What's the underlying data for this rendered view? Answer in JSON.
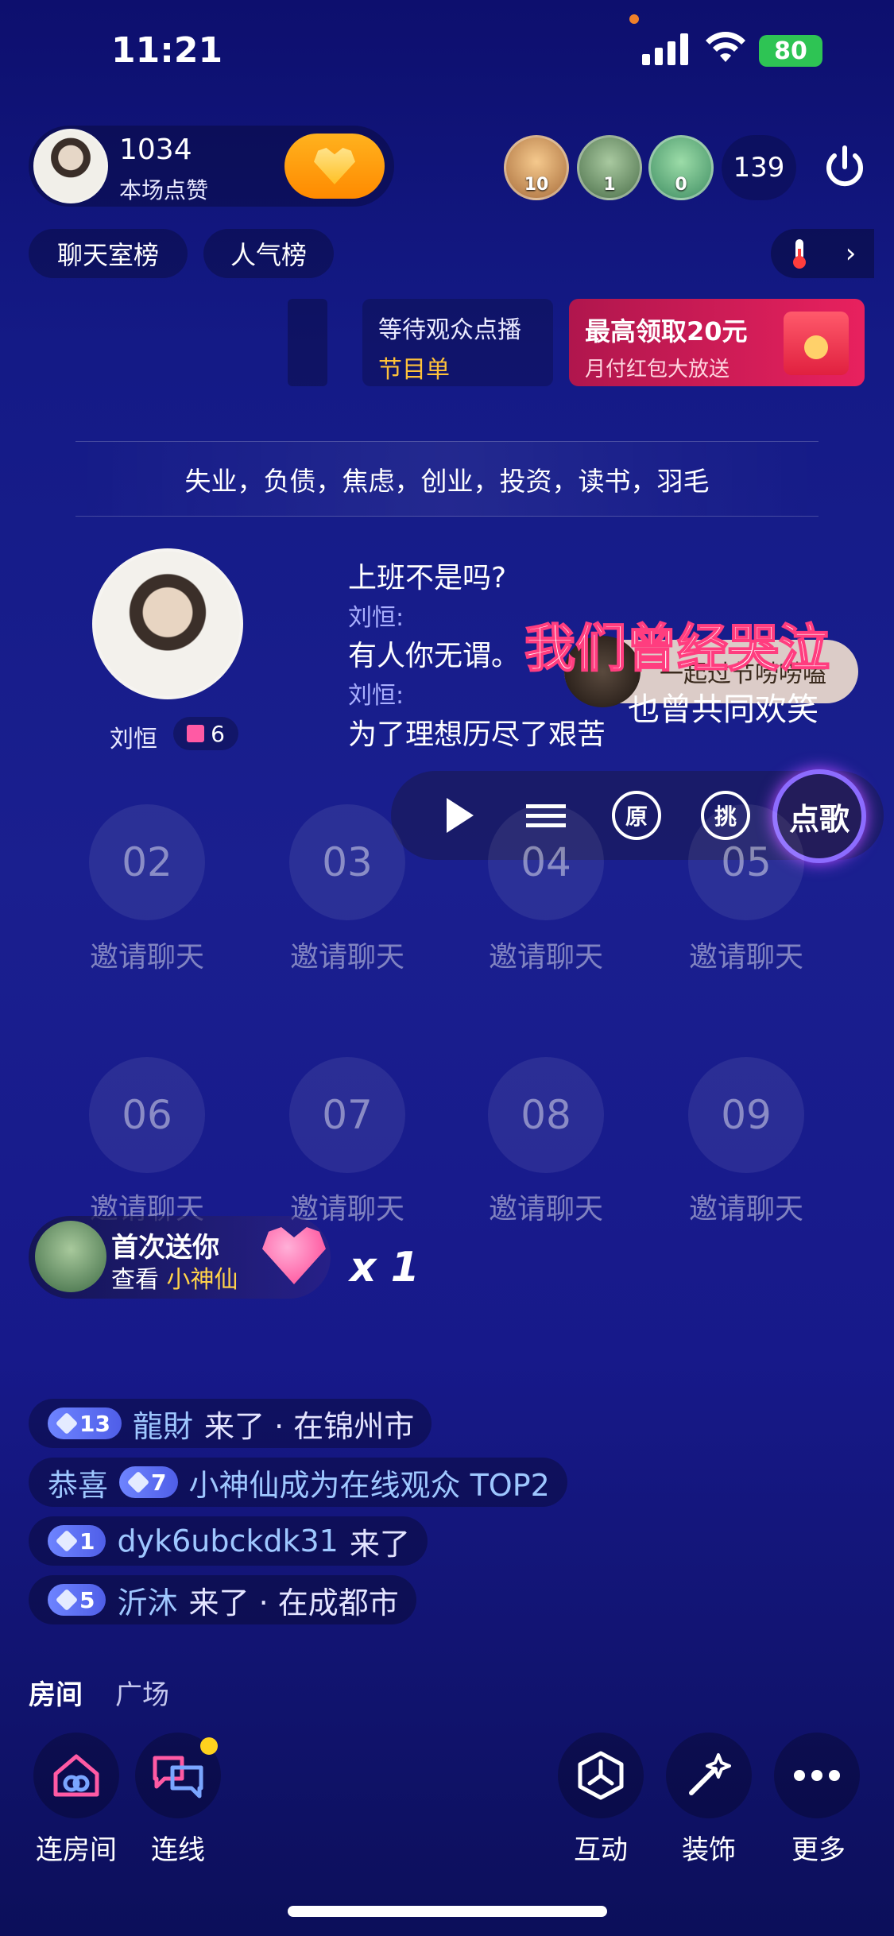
{
  "status": {
    "time": "11:21",
    "battery": "80"
  },
  "host": {
    "likes": "1034",
    "likes_label": "本场点赞"
  },
  "viewers": [
    {
      "count": "10"
    },
    {
      "count": "1"
    },
    {
      "count": "0"
    }
  ],
  "online_count": "139",
  "rank_tabs": [
    "聊天室榜",
    "人气榜"
  ],
  "wait_box": {
    "line1": "等待观众点播",
    "line2": "节目单"
  },
  "promo": {
    "title": "最高领取20元",
    "subtitle": "月付红包大放送"
  },
  "topics": "失业，负债，焦虑，创业，投资，读书，羽毛",
  "singer": {
    "name": "刘恒",
    "gifts": "6"
  },
  "chat": [
    {
      "text": "上班不是吗?"
    },
    {
      "label": "刘恒:"
    },
    {
      "text": "有人你无谓。"
    },
    {
      "label": "刘恒:"
    },
    {
      "text": "为了理想历尽了艰苦"
    }
  ],
  "lyrics": {
    "overlay1": "我们曾经哭泣",
    "overlay2": "也曾共同欢笑",
    "song_chip": "一起过节唠唠嗑"
  },
  "controls": {
    "yuan": "原",
    "tiao": "挑",
    "dianke": "点歌"
  },
  "seats": [
    {
      "num": "02",
      "label": "邀请聊天"
    },
    {
      "num": "03",
      "label": "邀请聊天"
    },
    {
      "num": "04",
      "label": "邀请聊天"
    },
    {
      "num": "05",
      "label": "邀请聊天"
    },
    {
      "num": "06",
      "label": "邀请聊天"
    },
    {
      "num": "07",
      "label": "邀请聊天"
    },
    {
      "num": "08",
      "label": "邀请聊天"
    },
    {
      "num": "09",
      "label": "邀请聊天"
    }
  ],
  "gift_toast": {
    "title": "首次送你",
    "prefix": "查看",
    "name": "小神仙",
    "count": "x 1"
  },
  "feed": [
    {
      "level": "13",
      "name": "龍財",
      "text": "来了 · 在锦州市"
    },
    {
      "prefix": "恭喜",
      "level": "7",
      "text": "小神仙成为在线观众 TOP2"
    },
    {
      "level": "1",
      "name": "dyk6ubckdk31",
      "text": "来了"
    },
    {
      "level": "5",
      "name": "沂沐",
      "text": "来了 · 在成都市"
    }
  ],
  "bottom_tabs": [
    "房间",
    "广场"
  ],
  "bottom_actions": [
    "连房间",
    "连线",
    "互动",
    "装饰",
    "更多"
  ],
  "colors": {
    "accent_orange": "#ff9d10",
    "promo_red": "#e8215e",
    "level_blue": "#5b6ef0",
    "bg": "#141a86"
  }
}
